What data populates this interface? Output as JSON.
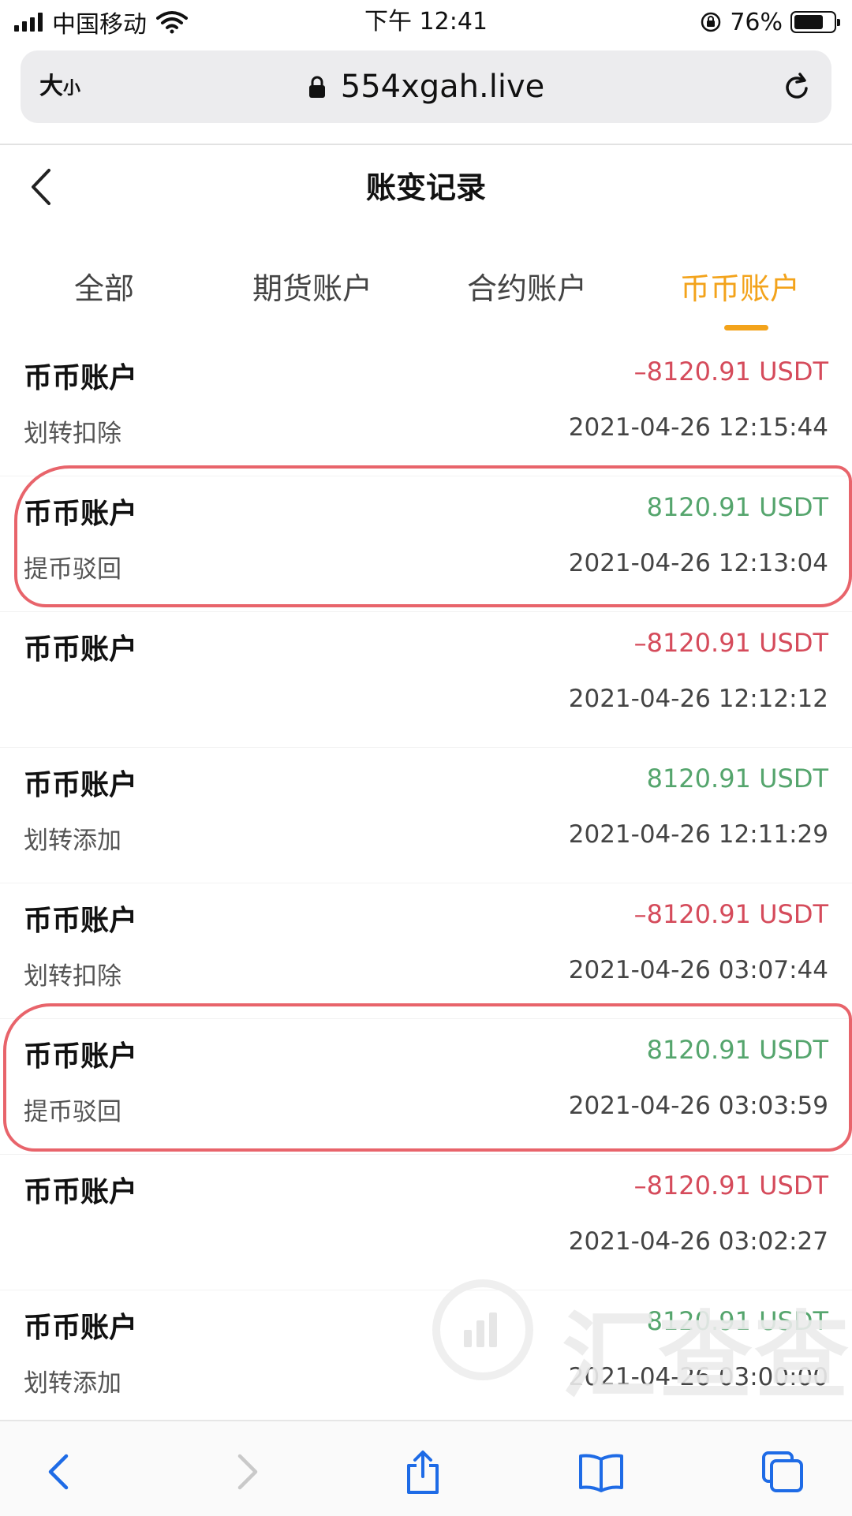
{
  "status_bar": {
    "carrier": "中国移动",
    "time": "下午 12:41",
    "battery_percent": "76%",
    "battery_level": 0.76
  },
  "browser": {
    "text_size_label": "大",
    "text_size_small": "小",
    "url": "554xgah.live"
  },
  "header": {
    "title": "账变记录"
  },
  "tabs": [
    {
      "label": "全部",
      "active": false
    },
    {
      "label": "期货账户",
      "active": false
    },
    {
      "label": "合约账户",
      "active": false
    },
    {
      "label": "币币账户",
      "active": true
    }
  ],
  "records": [
    {
      "account": "币币账户",
      "amount": "–8120.91 USDT",
      "type": "划转扣除",
      "time": "2021-04-26 12:15:44",
      "sign": "neg"
    },
    {
      "account": "币币账户",
      "amount": "8120.91 USDT",
      "type": "提币驳回",
      "time": "2021-04-26 12:13:04",
      "sign": "pos"
    },
    {
      "account": "币币账户",
      "amount": "–8120.91 USDT",
      "type": "",
      "time": "2021-04-26 12:12:12",
      "sign": "neg"
    },
    {
      "account": "币币账户",
      "amount": "8120.91 USDT",
      "type": "划转添加",
      "time": "2021-04-26 12:11:29",
      "sign": "pos"
    },
    {
      "account": "币币账户",
      "amount": "–8120.91 USDT",
      "type": "划转扣除",
      "time": "2021-04-26 03:07:44",
      "sign": "neg"
    },
    {
      "account": "币币账户",
      "amount": "8120.91 USDT",
      "type": "提币驳回",
      "time": "2021-04-26 03:03:59",
      "sign": "pos"
    },
    {
      "account": "币币账户",
      "amount": "–8120.91 USDT",
      "type": "",
      "time": "2021-04-26 03:02:27",
      "sign": "neg"
    },
    {
      "account": "币币账户",
      "amount": "8120.91 USDT",
      "type": "划转添加",
      "time": "2021-04-26 03:00:00",
      "sign": "pos"
    }
  ],
  "watermark": {
    "text": "汇查查"
  },
  "colors": {
    "accent": "#f3a31b",
    "negative": "#d54b5b",
    "positive": "#55a56d",
    "annotation": "#e8646b"
  }
}
